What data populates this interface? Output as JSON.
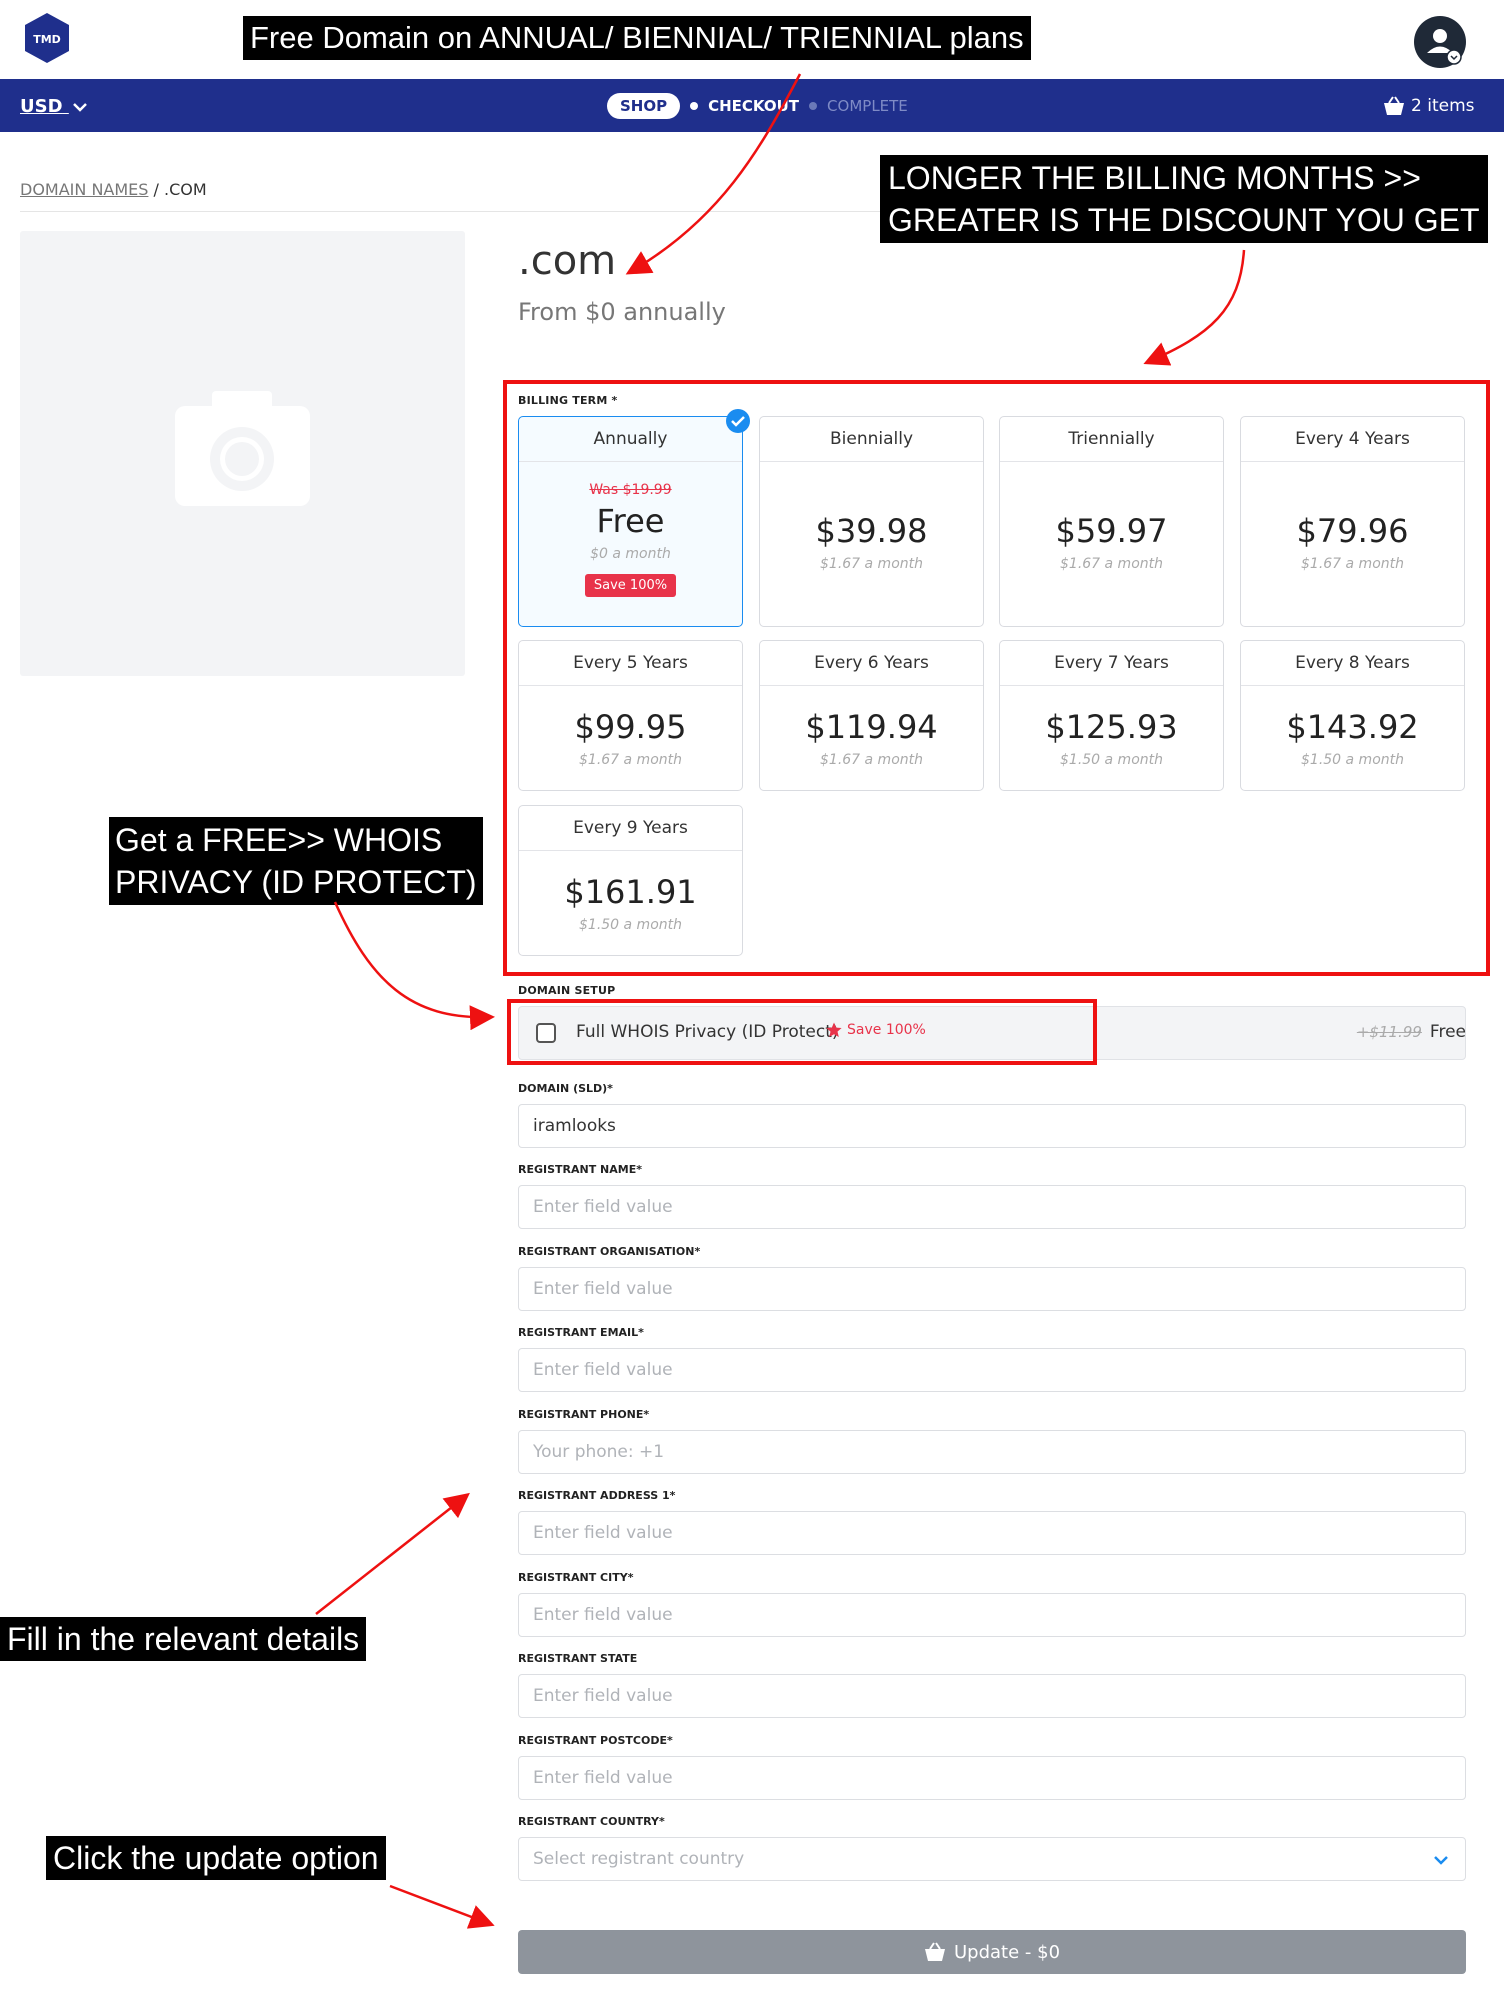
{
  "header": {
    "logo_text": "TMD",
    "currency": "USD",
    "steps": [
      "SHOP",
      "CHECKOUT",
      "COMPLETE"
    ],
    "cart": "2 items"
  },
  "breadcrumb": {
    "parent": "DOMAIN NAMES",
    "separator": "/",
    "current": ".COM"
  },
  "product": {
    "title": ".com",
    "subtitle": "From $0 annually"
  },
  "billing": {
    "label": "BILLING TERM *",
    "terms": [
      {
        "name": "Annually",
        "was": "Was $19.99",
        "price": "Free",
        "monthly": "$0 a month",
        "badge": "Save 100%"
      },
      {
        "name": "Biennially",
        "price": "$39.98",
        "monthly": "$1.67 a month"
      },
      {
        "name": "Triennially",
        "price": "$59.97",
        "monthly": "$1.67 a month"
      },
      {
        "name": "Every 4 Years",
        "price": "$79.96",
        "monthly": "$1.67 a month"
      },
      {
        "name": "Every 5 Years",
        "price": "$99.95",
        "monthly": "$1.67 a month"
      },
      {
        "name": "Every 6 Years",
        "price": "$119.94",
        "monthly": "$1.67 a month"
      },
      {
        "name": "Every 7 Years",
        "price": "$125.93",
        "monthly": "$1.50 a month"
      },
      {
        "name": "Every 8 Years",
        "price": "$143.92",
        "monthly": "$1.50 a month"
      },
      {
        "name": "Every 9 Years",
        "price": "$161.91",
        "monthly": "$1.50 a month"
      }
    ]
  },
  "setup": {
    "label": "DOMAIN SETUP",
    "whois": "Full WHOIS Privacy (ID Protect)",
    "save": "Save 100%",
    "old_price": "$11.99",
    "price": "Free"
  },
  "form": {
    "sld_label": "DOMAIN (SLD)*",
    "sld_value": "iramlooks",
    "name_label": "REGISTRANT NAME*",
    "org_label": "REGISTRANT ORGANISATION*",
    "email_label": "REGISTRANT EMAIL*",
    "phone_label": "REGISTRANT PHONE*",
    "phone_placeholder": "Your phone: +1",
    "address_label": "REGISTRANT ADDRESS 1*",
    "city_label": "REGISTRANT CITY*",
    "state_label": "REGISTRANT STATE",
    "postcode_label": "REGISTRANT POSTCODE*",
    "country_label": "REGISTRANT COUNTRY*",
    "country_placeholder": "Select registrant country",
    "field_placeholder": "Enter field value",
    "update_button": "Update - $0"
  },
  "annotations": {
    "free_domain": "Free Domain on ANNUAL/ BIENNIAL/ TRIENNIAL plans",
    "longer_1": "LONGER THE BILLING MONTHS >>",
    "longer_2": "GREATER IS THE DISCOUNT YOU GET",
    "whois_1": "Get a FREE>> WHOIS",
    "whois_2": "PRIVACY (ID PROTECT)",
    "fill": "Fill in the relevant details",
    "click": "Click the update option"
  },
  "colors": {
    "nav": "#1f2f8c",
    "accent": "#1a8cf0",
    "danger": "#e8334a",
    "annotation_red": "#ee1111"
  }
}
